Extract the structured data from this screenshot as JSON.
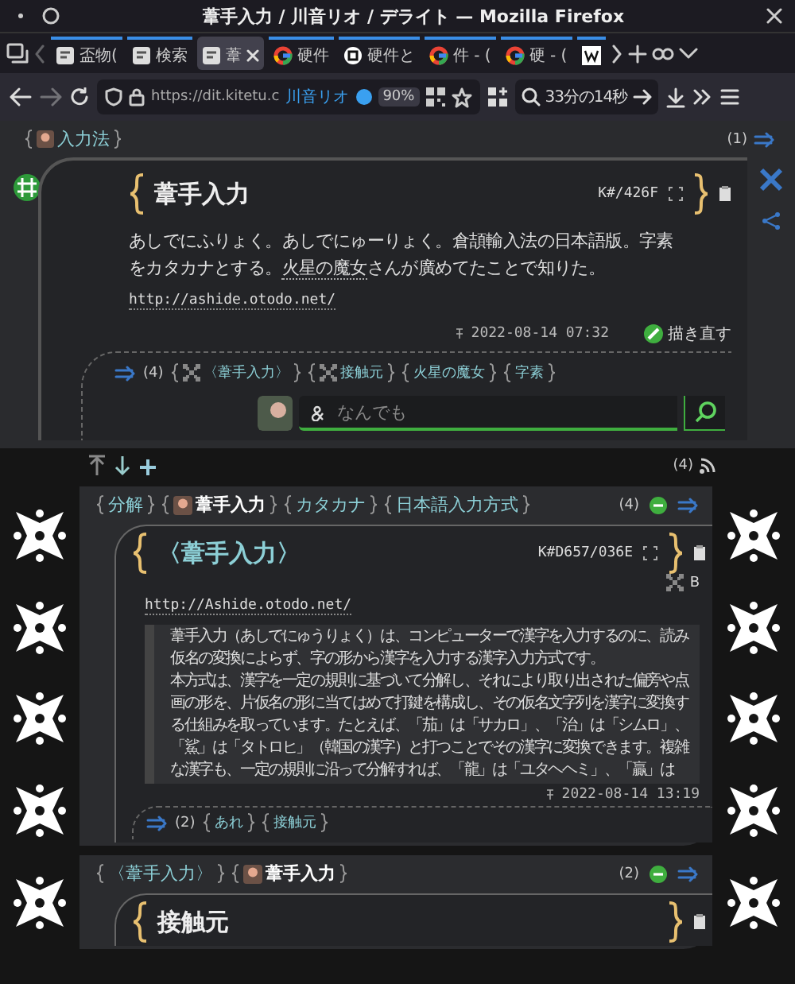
{
  "window": {
    "title": "葦手入力 / 川音リオ / デライト — Mozilla Firefox"
  },
  "tabs": [
    {
      "label": "盃物(",
      "kind": "site",
      "selected": false
    },
    {
      "label": "検索",
      "kind": "site",
      "selected": false
    },
    {
      "label": "葦",
      "kind": "site",
      "selected": true
    },
    {
      "label": "硬件",
      "kind": "google",
      "selected": false
    },
    {
      "label": "硬件と",
      "kind": "circle",
      "selected": false
    },
    {
      "label": "件 - (",
      "kind": "google",
      "selected": false
    },
    {
      "label": "硬 - (",
      "kind": "google",
      "selected": false
    },
    {
      "kind": "wiki",
      "selected": false
    }
  ],
  "address_bar": {
    "url": "https://dit.kitetu.c",
    "identity": "川音リオ",
    "zoom": "90%"
  },
  "search_bar": {
    "value": "33分の14秒"
  },
  "breadcrumb": {
    "label": "入力法",
    "count": "(1)"
  },
  "card": {
    "title": "葦手入力",
    "code": "K#/426F",
    "body": [
      {
        "text": "あしでにふりょく。あしでにゅーりょく。倉頡輸入法の日本語版。字素をカタカナとする。",
        "kind": "text"
      },
      {
        "text": "火星の魔女",
        "kind": "link"
      },
      {
        "text": "さんが廣めてたことで知りた。",
        "kind": "text"
      }
    ],
    "url": "http://ashide.otodo.net/",
    "date": "2022-08-14 07:32",
    "redraw": "描き直す",
    "relations": {
      "count": "(4)",
      "tags": [
        {
          "label": "〈葦手入力〉",
          "icon": true
        },
        {
          "label": "接触元",
          "icon": true
        },
        {
          "label": "火星の魔女",
          "icon": false
        },
        {
          "label": "字素",
          "icon": false
        }
      ]
    }
  },
  "search": {
    "placeholder": "なんでも"
  },
  "toolbar": {
    "count": "(4)"
  },
  "sections": [
    {
      "tags": [
        {
          "label": "分解",
          "bold": false
        },
        {
          "label": "葦手入力",
          "bold": true
        },
        {
          "label": "カタカナ",
          "bold": false
        },
        {
          "label": "日本語入力方式",
          "bold": false
        }
      ],
      "count": "(4)",
      "card": {
        "title": "〈葦手入力〉",
        "linked": true,
        "code": "K#D657/036E",
        "mark": "B",
        "url": "http://Ashide.otodo.net/",
        "quote": [
          "葦手入力（あしでにゅうりょく）は、コンピューターで漢字を入力するのに、読み仮名の変換によらず、字の形から漢字を入力する漢字入力方式です。",
          "本方式は、漢字を一定の規則に基づいて分解し、それにより取り出された偏旁や点画の形を、片仮名の形に当てはめて打鍵を構成し、その仮名文字列を漢字に変換する仕組みを取っています。たとえば、「茄」は「サカロ」、「治」は「シムロ」、「鯊」は「タトロヒ」（韓国の漢字）と打つことでその漢字に変換できます。複雑な漢字も、一定の規則に沿って分解すれば、「龍」は「ユタヘヘミ」、「贏」は"
        ],
        "date": "2022-08-14 13:19",
        "relations": {
          "count": "(2)",
          "tags": [
            {
              "label": "あれ",
              "icon": false
            },
            {
              "label": "接触元",
              "icon": false
            }
          ]
        }
      }
    },
    {
      "tags": [
        {
          "label": "〈葦手入力〉",
          "bold": false
        },
        {
          "label": "葦手入力",
          "bold": true
        }
      ],
      "count": "(2)",
      "card": {
        "title": "接触元",
        "linked": false
      }
    }
  ]
}
